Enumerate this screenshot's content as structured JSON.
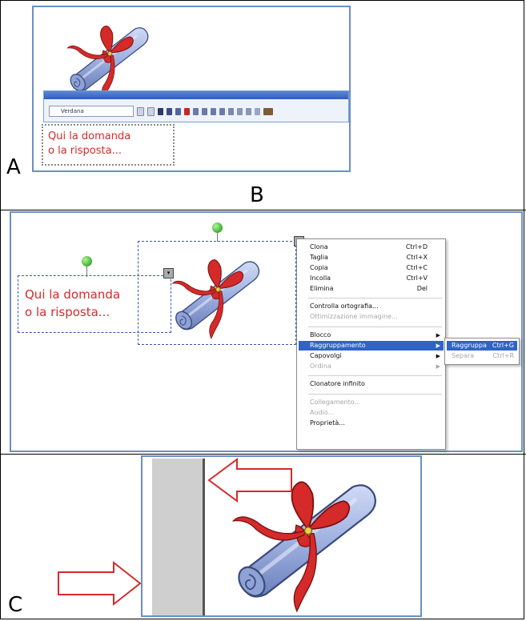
{
  "labels": {
    "a": "A",
    "b": "B",
    "c": "C"
  },
  "textbox": {
    "line1": "Qui la domanda",
    "line2": "o la risposta..."
  },
  "toolbar": {
    "select_value": "Verdana"
  },
  "context_menu": {
    "items": [
      {
        "label": "Clona",
        "shortcut": "Ctrl+D"
      },
      {
        "label": "Taglia",
        "shortcut": "Ctrl+X"
      },
      {
        "label": "Copia",
        "shortcut": "Ctrl+C"
      },
      {
        "label": "Incolla",
        "shortcut": "Ctrl+V"
      },
      {
        "label": "Elimina",
        "shortcut": "Del"
      },
      {
        "label": "Controlla ortografia..."
      },
      {
        "label": "Ottimizzazione immagine..."
      },
      {
        "label": "Blocco"
      },
      {
        "label": "Raggruppamento"
      },
      {
        "label": "Capovolgi"
      },
      {
        "label": "Ordina"
      },
      {
        "label": "Clonatore infinito"
      },
      {
        "label": "Collegamento..."
      },
      {
        "label": "Audio..."
      },
      {
        "label": "Proprietà..."
      }
    ],
    "submenu": [
      {
        "label": "Raggruppa",
        "shortcut": "Ctrl+G"
      },
      {
        "label": "Separa",
        "shortcut": "Ctrl+R"
      }
    ]
  },
  "colors": {
    "panel_border": "#6a8fc6",
    "highlight": "#3163c5",
    "ribbon": "#d42a2a",
    "scroll": "#aab8e0",
    "text_red": "#d22c2c",
    "arrow": "#d42a2a"
  }
}
